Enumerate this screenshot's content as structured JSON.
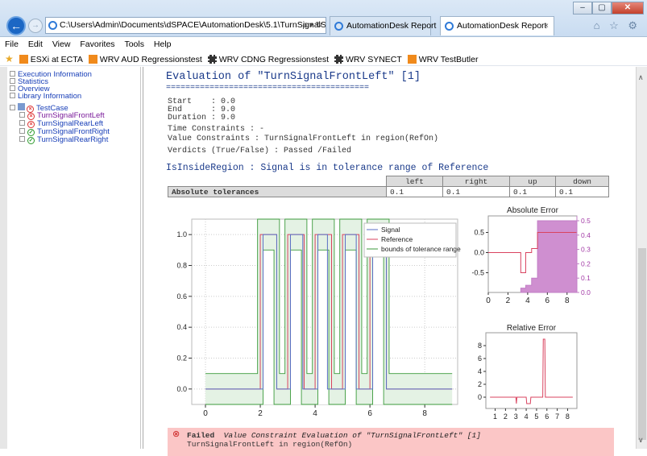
{
  "browser": {
    "address": "C:\\Users\\Admin\\Documents\\dSPACE\\AutomationDesk\\5.1\\TurnSignalSBT\\1",
    "address_controls": "ρ ▾ ↻",
    "tabs": [
      {
        "label": "AutomationDesk Report",
        "active": false
      },
      {
        "label": "AutomationDesk Report",
        "active": true,
        "close": "×"
      }
    ],
    "window_buttons": {
      "minimize": "–",
      "maximize": "▢",
      "close": "✕"
    },
    "toolbar_icons": "⌂ ☆ ⚙"
  },
  "menu": [
    "File",
    "Edit",
    "View",
    "Favorites",
    "Tools",
    "Help"
  ],
  "favorites": [
    {
      "label": "ESXi at ECTA",
      "icon": "orange-box-icon"
    },
    {
      "label": "WRV AUD Regressionstest",
      "icon": "orange-box-icon"
    },
    {
      "label": "WRV CDNG Regressionstest",
      "icon": "grid-icon"
    },
    {
      "label": "WRV SYNECT",
      "icon": "grid-icon"
    },
    {
      "label": "WRV TestButler",
      "icon": "orange-box-icon"
    }
  ],
  "sidebar": {
    "links": [
      "Execution Information",
      "Statistics",
      "Overview",
      "Library Information"
    ],
    "testcase": "TestCase",
    "items": [
      {
        "label": "TurnSignalFrontLeft",
        "status": "failed"
      },
      {
        "label": "TurnSignalRearLeft",
        "status": "failed"
      },
      {
        "label": "TurnSignalFrontRight",
        "status": "passed"
      },
      {
        "label": "TurnSignalRearRight",
        "status": "passed"
      }
    ]
  },
  "report": {
    "title": "Evaluation of \"TurnSignalFrontLeft\" [1]",
    "rule": "==========================================",
    "start": "Start    : 0.0",
    "end": "End      : 9.0",
    "duration": "Duration : 9.0",
    "time_constraints": "Time Constraints : -",
    "value_constraints": "Value Constraints : TurnSignalFrontLeft in region(RefOn)",
    "verdicts": "Verdicts (True/False) : Passed /Failed",
    "section": "IsInsideRegion : Signal is in tolerance range of Reference",
    "tol_headers": [
      "left",
      "right",
      "up",
      "down"
    ],
    "tol_row_label": "Absolute tolerances",
    "tol_values": [
      "0.1",
      "0.1",
      "0.1",
      "0.1"
    ],
    "fail_status": "Failed",
    "fail_text": "Value Constraint Evaluation of \"TurnSignalFrontLeft\" [1]",
    "fail_detail": "TurnSignalFrontLeft in region(RefOn)"
  },
  "colors": {
    "signal": "#5a6fc4",
    "reference": "#d9435f",
    "bounds": "#3b9a3b",
    "fill": "#c27ec6",
    "title": "#1a3a8a"
  },
  "chart_data": [
    {
      "type": "line",
      "title": "",
      "x_ticks": [
        "0",
        "2",
        "4",
        "6",
        "8"
      ],
      "y_ticks": [
        "0.0",
        "0.2",
        "0.4",
        "0.6",
        "0.8",
        "1.0"
      ],
      "xlim": [
        -0.5,
        9.2
      ],
      "ylim": [
        -0.1,
        1.1
      ],
      "legend": [
        "Signal",
        "Reference",
        "bounds of tolerance range"
      ],
      "legend_position": "top-right",
      "reference_pulses": [
        [
          2.0,
          2.6
        ],
        [
          3.0,
          3.6
        ],
        [
          4.0,
          4.6
        ],
        [
          5.0,
          5.6
        ],
        [
          6.0,
          6.6
        ]
      ],
      "signal_pulses": [
        [
          2.1,
          2.6
        ],
        [
          3.1,
          3.55
        ],
        [
          4.1,
          4.45
        ],
        [
          5.1,
          5.5
        ],
        [
          6.1,
          6.6
        ]
      ],
      "tolerance": 0.1
    },
    {
      "type": "line",
      "title": "Absolute Error",
      "x_ticks": [
        "0",
        "2",
        "4",
        "6",
        "8"
      ],
      "y_ticks_left": [
        "0.5",
        "0.0",
        "-0.5"
      ],
      "y_ticks_right": [
        "0.5",
        "0.4",
        "0.3",
        "0.2",
        "0.1",
        "0.0"
      ],
      "points": [
        [
          0,
          0
        ],
        [
          3.3,
          0
        ],
        [
          3.3,
          -0.5
        ],
        [
          3.8,
          -0.5
        ],
        [
          3.8,
          0
        ],
        [
          4.4,
          0
        ],
        [
          4.4,
          0.1
        ],
        [
          5.0,
          0.1
        ],
        [
          5.0,
          0.5
        ],
        [
          9.0,
          0.5
        ]
      ]
    },
    {
      "type": "line",
      "title": "Relative Error",
      "x_ticks": [
        "1",
        "2",
        "3",
        "4",
        "5",
        "6",
        "7",
        "8"
      ],
      "y_ticks": [
        "8",
        "6",
        "4",
        "2",
        "0"
      ],
      "points": [
        [
          0.5,
          0
        ],
        [
          3.0,
          0
        ],
        [
          3.05,
          -1
        ],
        [
          3.1,
          0
        ],
        [
          4.0,
          0
        ],
        [
          4.05,
          -1
        ],
        [
          4.4,
          -1
        ],
        [
          4.45,
          0
        ],
        [
          5.6,
          0
        ],
        [
          5.65,
          9
        ],
        [
          5.8,
          9
        ],
        [
          5.85,
          0
        ],
        [
          8.5,
          0
        ]
      ]
    }
  ]
}
